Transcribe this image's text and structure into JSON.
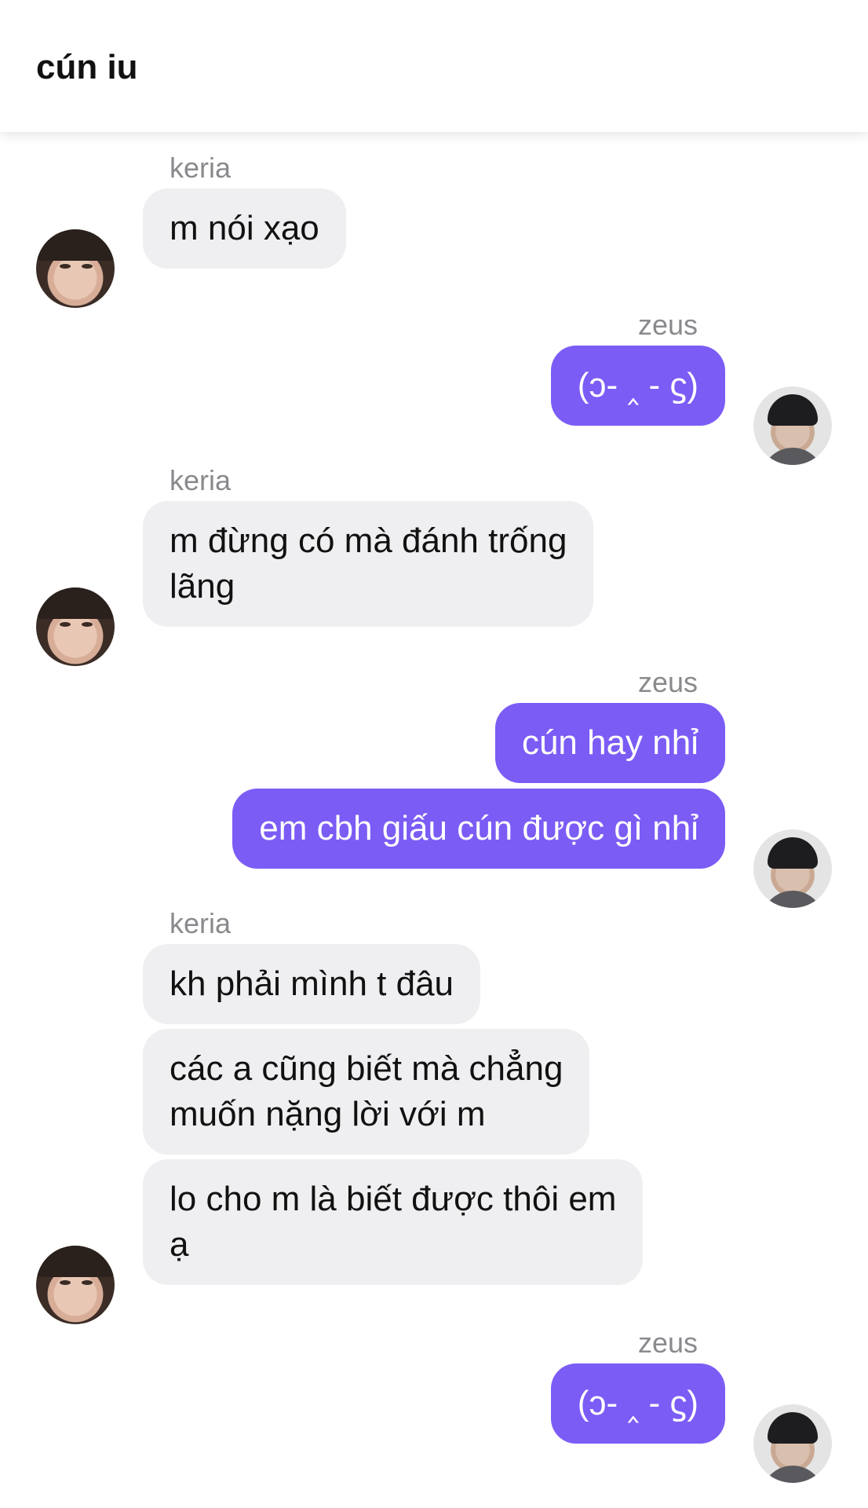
{
  "header": {
    "title": "cún iu"
  },
  "messages": [
    {
      "sender": "keria",
      "texts": [
        "m nói xạo"
      ]
    },
    {
      "sender": "zeus",
      "texts": [
        "(ↄ- ‸ - ϛ)"
      ]
    },
    {
      "sender": "keria",
      "texts": [
        "m đừng có mà đánh trống\nlãng"
      ]
    },
    {
      "sender": "zeus",
      "texts": [
        "cún hay nhỉ",
        "em cbh giấu cún được gì nhỉ"
      ]
    },
    {
      "sender": "keria",
      "texts": [
        "kh phải mình t đâu",
        "các a cũng biết mà chẳng\nmuốn nặng lời với m",
        "lo cho m là biết được thôi em\nạ"
      ]
    },
    {
      "sender": "zeus",
      "texts": [
        "(ↄ- ‸ - ϛ)"
      ]
    }
  ],
  "colors": {
    "outgoing_bubble": "#7b5cf5",
    "incoming_bubble": "#efeff1",
    "sender_label": "#8a8a8e"
  },
  "icons": {
    "keria_avatar": "avatar-keria",
    "zeus_avatar": "avatar-zeus"
  }
}
